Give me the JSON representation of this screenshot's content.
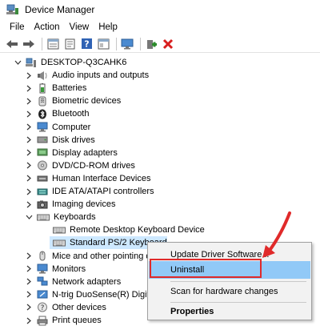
{
  "window": {
    "title": "Device Manager"
  },
  "menu": [
    "File",
    "Action",
    "View",
    "Help"
  ],
  "toolbar": {
    "icons": [
      "back-arrow-icon",
      "forward-arrow-icon",
      "properties-icon",
      "update-icon",
      "help-icon",
      "view-icon",
      "monitor-icon",
      "add-driver-icon",
      "uninstall-x-icon"
    ],
    "colors": {
      "uninstall_x": "#d81e1e",
      "add_driver": "#2b8a2b"
    }
  },
  "tree": {
    "root": "DESKTOP-Q3CAHK6",
    "items": [
      {
        "label": "Audio inputs and outputs",
        "icon": "speaker-icon"
      },
      {
        "label": "Batteries",
        "icon": "battery-icon"
      },
      {
        "label": "Biometric devices",
        "icon": "biometric-icon"
      },
      {
        "label": "Bluetooth",
        "icon": "bluetooth-icon"
      },
      {
        "label": "Computer",
        "icon": "computer-icon"
      },
      {
        "label": "Disk drives",
        "icon": "disk-icon"
      },
      {
        "label": "Display adapters",
        "icon": "display-icon"
      },
      {
        "label": "DVD/CD-ROM drives",
        "icon": "dvd-icon"
      },
      {
        "label": "Human Interface Devices",
        "icon": "hid-icon"
      },
      {
        "label": "IDE ATA/ATAPI controllers",
        "icon": "ide-icon"
      },
      {
        "label": "Imaging devices",
        "icon": "camera-icon"
      },
      {
        "label": "Keyboards",
        "icon": "keyboard-icon",
        "expanded": true
      },
      {
        "label": "Remote Desktop Keyboard Device",
        "icon": "keyboard-icon",
        "child": true
      },
      {
        "label": "Standard PS/2 Keyboard",
        "icon": "keyboard-icon",
        "child": true,
        "selected": true
      },
      {
        "label": "Mice and other pointing devices",
        "icon": "mouse-icon"
      },
      {
        "label": "Monitors",
        "icon": "monitor-icon"
      },
      {
        "label": "Network adapters",
        "icon": "network-icon"
      },
      {
        "label": "N-trig DuoSense(R) Digitizer",
        "icon": "digitizer-icon"
      },
      {
        "label": "Other devices",
        "icon": "other-device-icon"
      },
      {
        "label": "Print queues",
        "icon": "printer-icon"
      }
    ]
  },
  "context_menu": {
    "items": [
      {
        "label": "Update Driver Software..."
      },
      {
        "label": "Uninstall",
        "hover": true
      },
      {
        "label": "Scan for hardware changes"
      },
      {
        "label": "Properties",
        "bold": true
      }
    ]
  },
  "annotation": {
    "color": "#e02a2a"
  }
}
